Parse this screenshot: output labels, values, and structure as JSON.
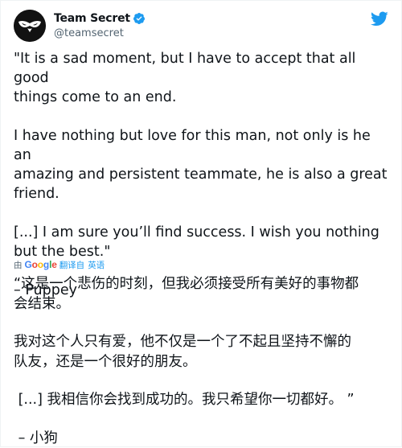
{
  "tweet": {
    "display_name": "Team Secret",
    "handle": "@teamsecret",
    "paragraphs": [
      "\"It is a sad moment, but I have to accept that all good\nthings come to an end.",
      "I have nothing but love for this man, not only is he an\namazing and persistent teammate, he is also a great\nfriend.",
      "[...] I am sure you’ll find success. I wish you nothing\nbut the best.\""
    ],
    "signature": "– Puppey"
  },
  "translation": {
    "by": "由",
    "google_letters": [
      "G",
      "o",
      "o",
      "g",
      "l",
      "e"
    ],
    "translated_from": "翻译自",
    "language": "英语",
    "paragraphs": [
      "“这是一个悲伤的时刻，但我必须接受所有美好的事物都\n会结束。",
      "我对这个人只有爱，他不仅是一个了不起且坚持不懈的\n队友，还是一个很好的朋友。",
      " [...] 我相信你会找到成功的。我只希望你一切都好。 ”"
    ],
    "signature": " – 小狗"
  },
  "icons": {
    "avatar": "team-secret-logo",
    "verified": "verified-badge-icon",
    "twitter": "twitter-bird-icon"
  },
  "colors": {
    "verified_blue": "#1d9bf0",
    "twitter_blue": "#1d9bf0",
    "secondary_text": "#536471"
  }
}
